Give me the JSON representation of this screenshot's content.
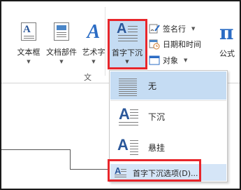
{
  "ribbon": {
    "group_label": "文",
    "buttons": {
      "textbox_label": "文本框",
      "docparts_label": "文档部件",
      "wordart_label": "艺术字",
      "dropcap_label": "首字下沉",
      "signature_label": "签名行",
      "datetime_label": "日期和时间",
      "object_label": "对象",
      "formula_label": "公式"
    },
    "arrow": "▼",
    "formula_symbol": "π"
  },
  "dropcap_menu": {
    "items": [
      {
        "label": "无",
        "icon": "no-dropcap-icon"
      },
      {
        "label": "下沉",
        "icon": "dropped-icon"
      },
      {
        "label": "悬挂",
        "icon": "in-margin-icon"
      }
    ],
    "options_label": "首字下沉选项(D)..."
  },
  "colors": {
    "accent": "#2b579a",
    "highlight": "#c5dcf3",
    "annotation": "#e8262b"
  }
}
